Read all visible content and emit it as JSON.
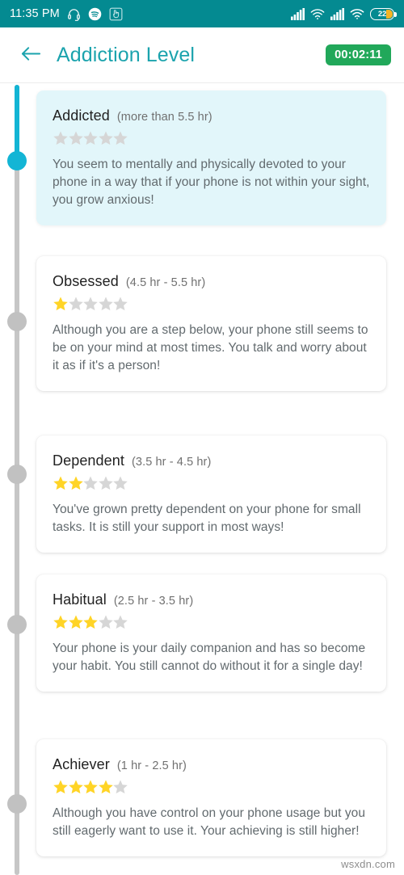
{
  "status_bar": {
    "time": "11:35 PM",
    "left_icons": [
      "headset-icon",
      "spotify-icon",
      "touch-assistant-icon"
    ],
    "right_icons": [
      "signal-bars-sim1-icon",
      "wifi-calling-icon",
      "signal-bars-sim2-icon",
      "wifi-icon"
    ],
    "battery_level": "22",
    "background_color": "#048a91",
    "battery_fill_color": "#f5b324"
  },
  "app_bar": {
    "back_icon": "arrow-left-icon",
    "title": "Addiction Level",
    "title_color": "#1ba3ad",
    "timer": "00:02:11",
    "timer_color": "#21a85a"
  },
  "timeline": {
    "active_color": "#13b5d5",
    "inactive_color": "#c1c1c1",
    "active_index": 0
  },
  "levels": [
    {
      "title": "Addicted",
      "range": "(more than 5.5 hr)",
      "stars_filled": 0,
      "stars_total": 5,
      "description": "You seem to mentally and physically devoted to your phone in a way that if your phone is not within your sight, you grow anxious!",
      "highlighted": true,
      "card_color": "#e2f6fa"
    },
    {
      "title": "Obsessed",
      "range": "(4.5 hr - 5.5 hr)",
      "stars_filled": 1,
      "stars_total": 5,
      "description": "Although you are a step below, your phone still seems to be on your mind at most times. You talk and worry about it as if it's a person!",
      "highlighted": false,
      "card_color": "#ffffff"
    },
    {
      "title": "Dependent",
      "range": "(3.5 hr - 4.5 hr)",
      "stars_filled": 2,
      "stars_total": 5,
      "description": "You've grown pretty dependent on your phone for small tasks. It is still your support in most ways!",
      "highlighted": false,
      "card_color": "#ffffff"
    },
    {
      "title": "Habitual",
      "range": "(2.5 hr - 3.5 hr)",
      "stars_filled": 3,
      "stars_total": 5,
      "description": "Your phone is your daily companion and has so become your habit. You still cannot do without it for a single day!",
      "highlighted": false,
      "card_color": "#ffffff"
    },
    {
      "title": "Achiever",
      "range": "(1 hr - 2.5 hr)",
      "stars_filled": 4,
      "stars_total": 5,
      "description": "Although you have control on your phone usage but you still eagerly want to use it. Your achieving is still higher!",
      "highlighted": false,
      "card_color": "#ffffff"
    }
  ],
  "star_colors": {
    "filled": "#ffd426",
    "empty": "#d6d6d6"
  },
  "watermark": "wsxdn.com"
}
